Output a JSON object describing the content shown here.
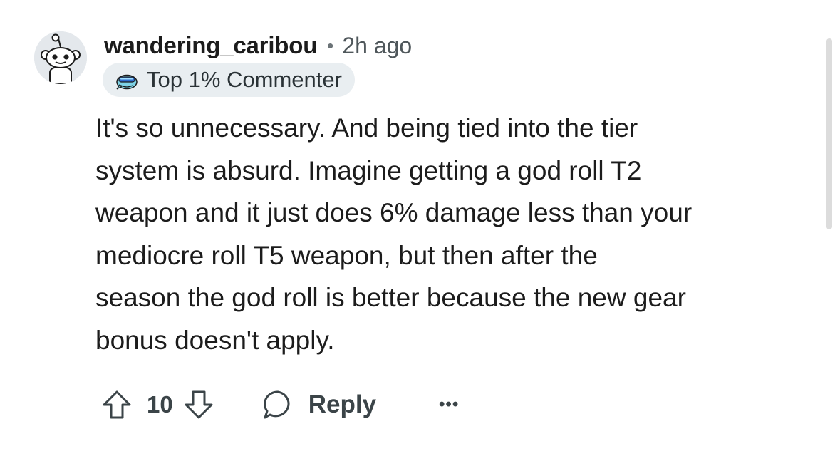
{
  "comment": {
    "author": "wandering_caribou",
    "separator": "•",
    "time_ago": "2h ago",
    "badge": {
      "icon": "top-commenter-badge-icon",
      "label": "Top 1% Commenter"
    },
    "body_lines": [
      "It's so unnecessary. And being tied into the tier",
      "system is absurd. Imagine getting a god roll T2",
      "weapon and it just does 6% damage less than your",
      "mediocre roll T5 weapon, but then after the",
      "season the god roll is better because the new gear",
      "bonus doesn't apply."
    ],
    "actions": {
      "vote_count": "10",
      "reply_label": "Reply",
      "more_label": "•••"
    }
  },
  "icons": {
    "avatar": "snoo-avatar-icon",
    "upvote": "upvote-arrow-icon",
    "downvote": "downvote-arrow-icon",
    "reply": "speech-bubble-icon",
    "more": "more-options-icon"
  },
  "colors": {
    "text": "#1c1c1c",
    "muted": "#4f575b",
    "badge_bg": "#e9eef1",
    "action": "#3b4448"
  }
}
